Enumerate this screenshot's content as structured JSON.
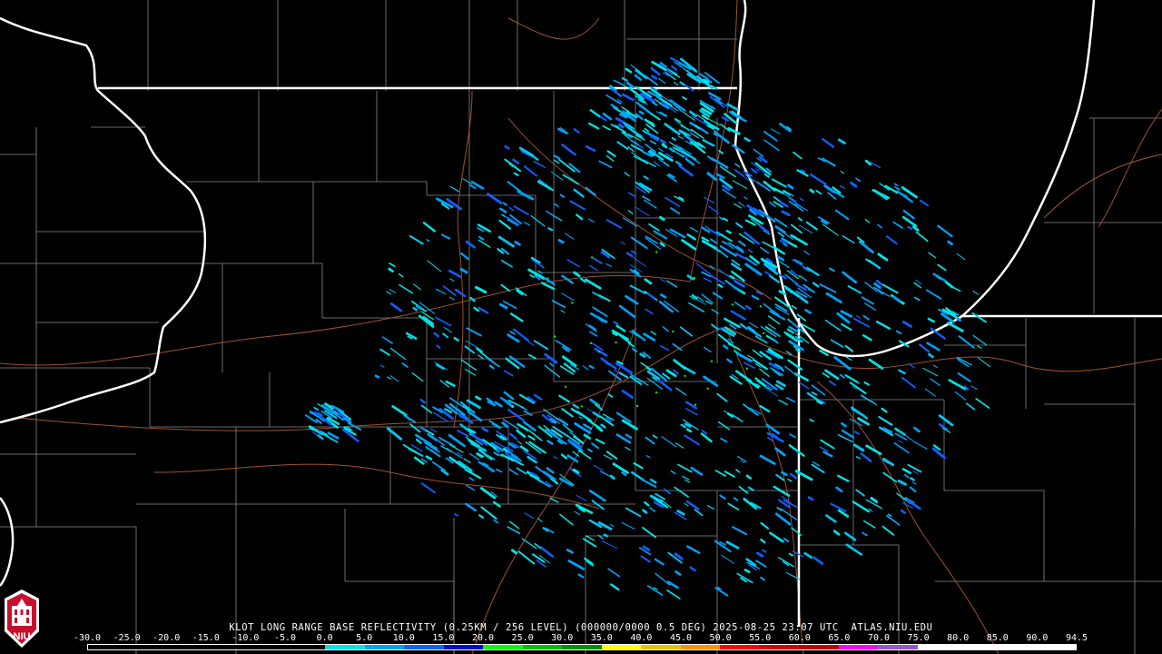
{
  "product": {
    "caption": "KLOT LONG RANGE BASE REFLECTIVITY (0.25KM / 256 LEVEL) (000000/0000 0.5 DEG) 2025-08-25 23:07 UTC  ATLAS.NIU.EDU"
  },
  "logo": {
    "text": "NIU",
    "colors": {
      "background": "#c8102e",
      "text": "#ffffff"
    }
  },
  "scale": {
    "ticks": [
      "-30.0",
      "-25.0",
      "-20.0",
      "-15.0",
      "-10.0",
      "-5.0",
      "0.0",
      "5.0",
      "10.0",
      "15.0",
      "20.0",
      "25.0",
      "30.0",
      "35.0",
      "40.0",
      "45.0",
      "50.0",
      "55.0",
      "60.0",
      "65.0",
      "70.0",
      "75.0",
      "80.0",
      "85.0",
      "90.0",
      "94.5"
    ],
    "colors": [
      "#000000",
      "#000000",
      "#000000",
      "#000000",
      "#000000",
      "#000000",
      "#00e5e5",
      "#00a0f5",
      "#1060ff",
      "#0010d0",
      "#00ff00",
      "#00c000",
      "#009000",
      "#ffff00",
      "#e7c000",
      "#ff9000",
      "#ff0000",
      "#d60000",
      "#c00000",
      "#ff00ff",
      "#9955c9",
      "#ffffff",
      "#ffffff",
      "#ffffff",
      "#ffffff"
    ]
  },
  "map_style": {
    "state_border": "#ffffff",
    "county_border": "#8a8a8a",
    "highway": "#a0522d",
    "background": "#000000"
  }
}
